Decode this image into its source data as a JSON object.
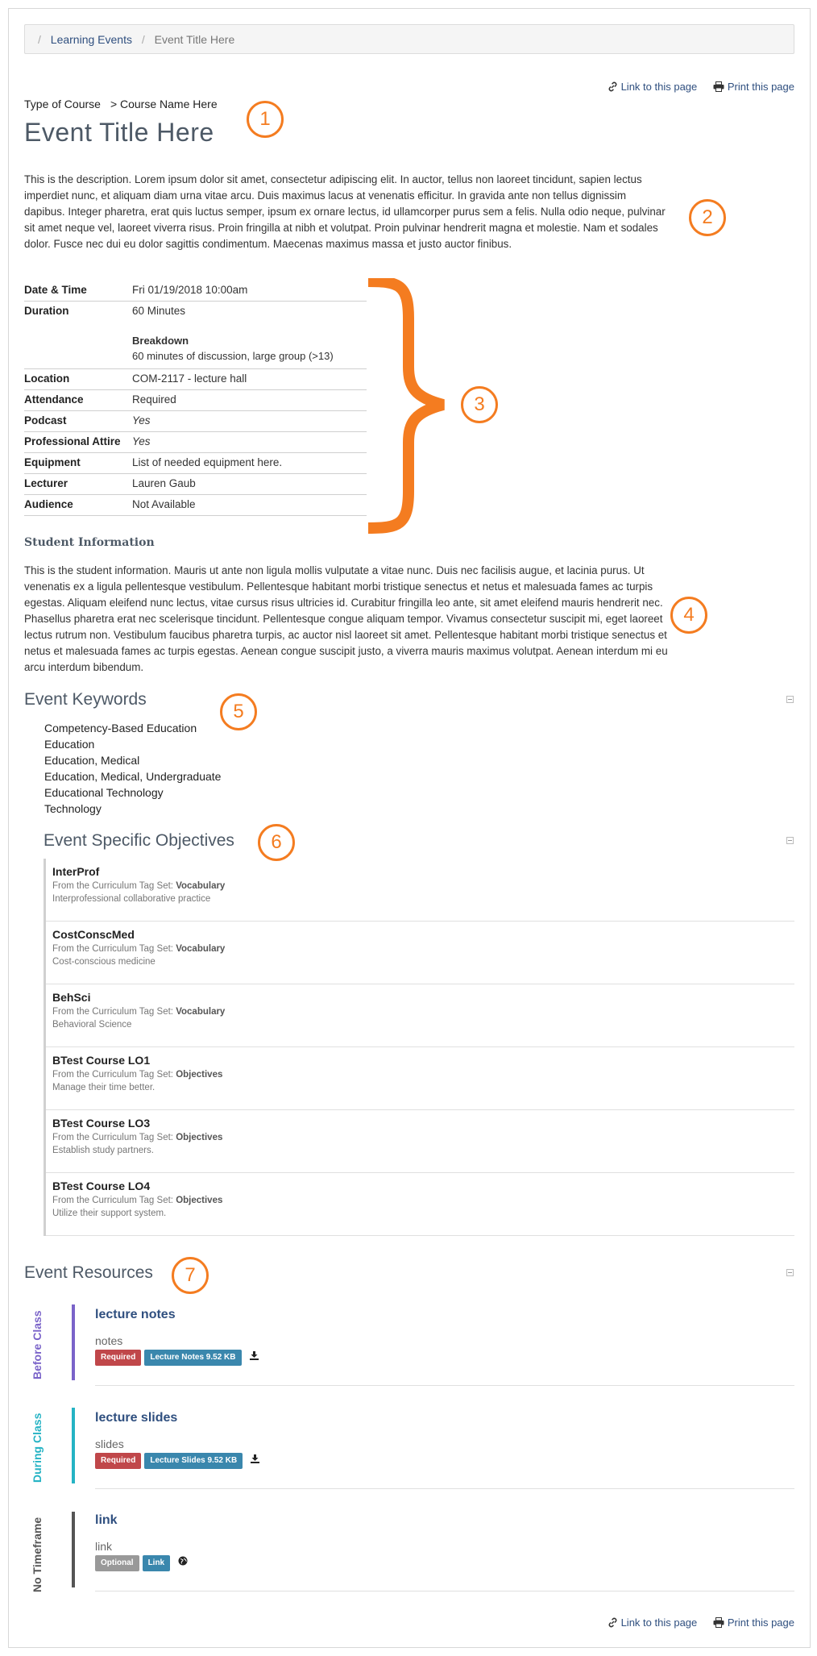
{
  "breadcrumb": {
    "items": [
      "Learning Events"
    ],
    "current": "Event Title Here"
  },
  "page_tools": {
    "link_label": "Link to this page",
    "print_label": "Print this page"
  },
  "event": {
    "course_type": "Type of Course",
    "course_name": "> Course Name Here",
    "title": "Event Title Here",
    "description": "This is the description. Lorem ipsum dolor sit amet, consectetur adipiscing elit. In auctor, tellus non laoreet tincidunt, sapien lectus imperdiet nunc, et aliquam diam urna vitae arcu. Duis maximus lacus at venenatis efficitur. In gravida ante non tellus dignissim dapibus. Integer pharetra, erat quis luctus semper, ipsum ex ornare lectus, id ullamcorper purus sem a felis. Nulla odio neque, pulvinar sit amet neque vel, laoreet viverra risus. Proin fringilla at nibh et volutpat. Proin pulvinar hendrerit magna et molestie. Nam et sodales dolor. Fusce nec dui eu dolor sagittis condimentum. Maecenas maximus massa et justo auctor finibus."
  },
  "details": {
    "date_time": {
      "label": "Date & Time",
      "value": "Fri 01/19/2018 10:00am"
    },
    "duration": {
      "label": "Duration",
      "value": "60 Minutes",
      "breakdown_title": "Breakdown",
      "breakdown_text": "60 minutes of discussion, large group (>13)"
    },
    "location": {
      "label": "Location",
      "value": "COM-2117 - lecture hall"
    },
    "attendance": {
      "label": "Attendance",
      "value": "Required"
    },
    "podcast": {
      "label": "Podcast",
      "value": "Yes"
    },
    "attire": {
      "label": "Professional Attire",
      "value": "Yes"
    },
    "equipment": {
      "label": "Equipment",
      "value": "List of needed equipment here."
    },
    "lecturer": {
      "label": "Lecturer",
      "value": "Lauren Gaub"
    },
    "audience": {
      "label": "Audience",
      "value": "Not Available"
    }
  },
  "student_info": {
    "heading": "Student Information",
    "text": "This is the student information. Mauris ut ante non ligula mollis vulputate a vitae nunc. Duis nec facilisis augue, et lacinia purus. Ut venenatis ex a ligula pellentesque vestibulum. Pellentesque habitant morbi tristique senectus et netus et malesuada fames ac turpis egestas. Aliquam eleifend nunc lectus, vitae cursus risus ultricies id. Curabitur fringilla leo ante, sit amet eleifend mauris hendrerit nec. Phasellus pharetra erat nec scelerisque tincidunt. Pellentesque congue aliquam tempor. Vivamus consectetur suscipit mi, eget laoreet lectus rutrum non. Vestibulum faucibus pharetra turpis, ac auctor nisl laoreet sit amet. Pellentesque habitant morbi tristique senectus et netus et malesuada fames ac turpis egestas. Aenean congue suscipit justo, a viverra mauris maximus volutpat. Aenean interdum mi eu arcu interdum bibendum."
  },
  "keywords": {
    "heading": "Event Keywords",
    "items": [
      "Competency-Based Education",
      "Education",
      "Education, Medical",
      "Education, Medical, Undergraduate",
      "Educational Technology",
      "Technology"
    ]
  },
  "objectives": {
    "heading": "Event Specific Objectives",
    "from_prefix": "From the Curriculum Tag Set:",
    "items": [
      {
        "name": "InterProf",
        "tag_set": "Vocabulary",
        "description": "Interprofessional collaborative practice"
      },
      {
        "name": "CostConscMed",
        "tag_set": "Vocabulary",
        "description": "Cost-conscious medicine"
      },
      {
        "name": "BehSci",
        "tag_set": "Vocabulary",
        "description": "Behavioral Science"
      },
      {
        "name": "BTest Course LO1",
        "tag_set": "Objectives",
        "description": "Manage their time better."
      },
      {
        "name": "BTest Course LO3",
        "tag_set": "Objectives",
        "description": "Establish study partners."
      },
      {
        "name": "BTest Course LO4",
        "tag_set": "Objectives",
        "description": "Utilize their support system."
      }
    ]
  },
  "resources": {
    "heading": "Event Resources",
    "groups": [
      {
        "timeframe": "Before Class",
        "color": "#7a63c9",
        "title": "lecture notes",
        "description": "notes",
        "badge1": "Required",
        "badge2": "Lecture Notes 9.52 KB",
        "action_icon": "download-icon"
      },
      {
        "timeframe": "During Class",
        "color": "#25b3c4",
        "title": "lecture slides",
        "description": "slides",
        "badge1": "Required",
        "badge2": "Lecture Slides 9.52 KB",
        "action_icon": "download-icon"
      },
      {
        "timeframe": "No Timeframe",
        "color": "#555555",
        "title": "link",
        "description": "link",
        "badge1": "Optional",
        "badge2": "Link",
        "action_icon": "globe-icon"
      }
    ]
  },
  "annotations": [
    "1",
    "2",
    "3",
    "4",
    "5",
    "6",
    "7"
  ],
  "colors": {
    "accent_orange": "#f47c20",
    "badge_required": "#c0474a",
    "badge_optional": "#999999",
    "badge_file": "#3a87ad",
    "link": "#2f4f7f"
  }
}
